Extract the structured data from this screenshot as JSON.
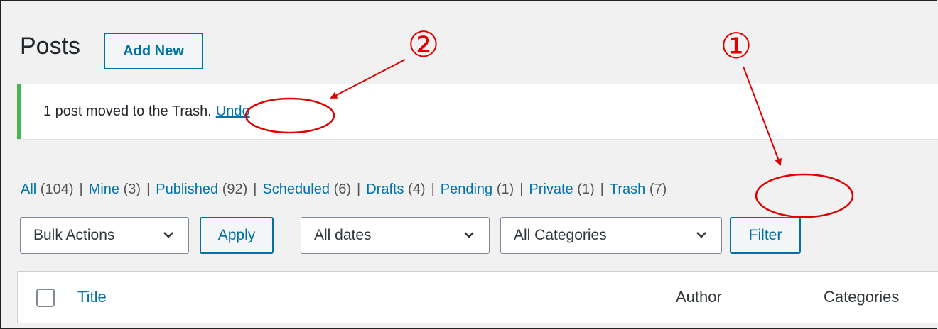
{
  "header": {
    "title": "Posts",
    "add_new_label": "Add New"
  },
  "notice": {
    "message": "1 post moved to the Trash.",
    "undo_label": "Undo"
  },
  "views": [
    {
      "label": "All",
      "count": "(104)"
    },
    {
      "label": "Mine",
      "count": "(3)"
    },
    {
      "label": "Published",
      "count": "(92)"
    },
    {
      "label": "Scheduled",
      "count": "(6)"
    },
    {
      "label": "Drafts",
      "count": "(4)"
    },
    {
      "label": "Pending",
      "count": "(1)"
    },
    {
      "label": "Private",
      "count": "(1)"
    },
    {
      "label": "Trash",
      "count": "(7)"
    }
  ],
  "tablenav": {
    "bulk_actions": "Bulk Actions",
    "apply_label": "Apply",
    "dates": "All dates",
    "categories": "All Categories",
    "filter_label": "Filter"
  },
  "table": {
    "columns": {
      "title": "Title",
      "author": "Author",
      "categories": "Categories"
    }
  },
  "annotations": {
    "marker_1": "①",
    "marker_2": "②",
    "color": "#e00000"
  },
  "colors": {
    "link": "#0073aa",
    "button_border": "#0071a1",
    "notice_success": "#46b450"
  }
}
